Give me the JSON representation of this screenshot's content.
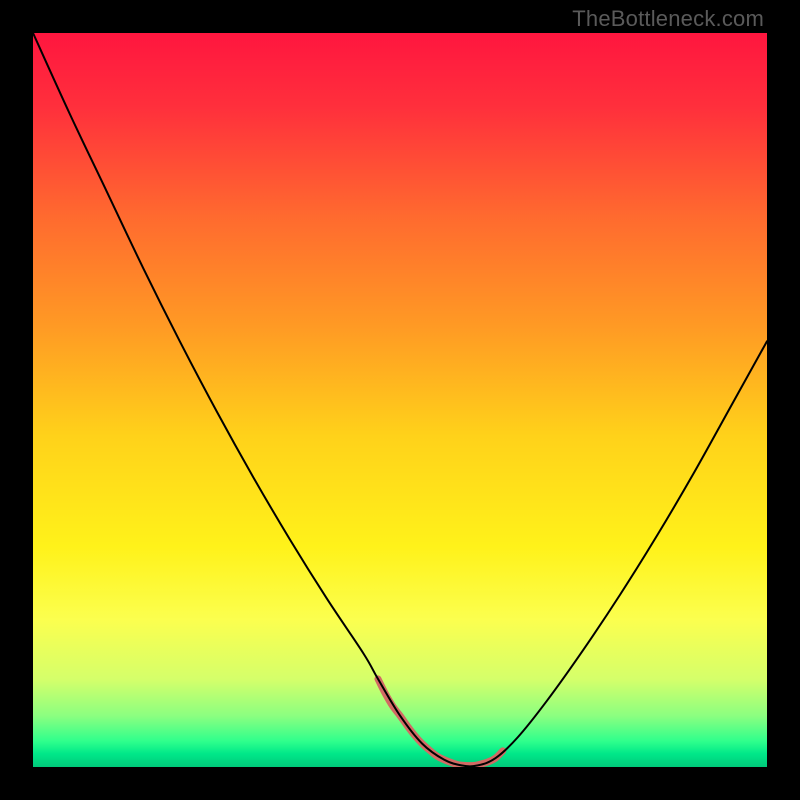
{
  "watermark": "TheBottleneck.com",
  "chart_data": {
    "type": "line",
    "title": "",
    "xlabel": "",
    "ylabel": "",
    "xlim": [
      0,
      100
    ],
    "ylim": [
      0,
      100
    ],
    "grid": false,
    "legend": false,
    "background_gradient": {
      "stops": [
        {
          "offset": 0.0,
          "color": "#ff163f"
        },
        {
          "offset": 0.1,
          "color": "#ff2f3c"
        },
        {
          "offset": 0.25,
          "color": "#ff6a2f"
        },
        {
          "offset": 0.4,
          "color": "#ff9a24"
        },
        {
          "offset": 0.55,
          "color": "#ffd21a"
        },
        {
          "offset": 0.7,
          "color": "#fff21a"
        },
        {
          "offset": 0.8,
          "color": "#fbff4f"
        },
        {
          "offset": 0.88,
          "color": "#d5ff6a"
        },
        {
          "offset": 0.93,
          "color": "#8cff80"
        },
        {
          "offset": 0.965,
          "color": "#2fff8c"
        },
        {
          "offset": 0.982,
          "color": "#00e889"
        },
        {
          "offset": 1.0,
          "color": "#00c97a"
        }
      ]
    },
    "series": [
      {
        "name": "curve",
        "stroke": "#000000",
        "stroke_width": 2,
        "x": [
          0.0,
          5.0,
          10.0,
          15.0,
          20.0,
          25.0,
          30.0,
          35.0,
          40.0,
          45.0,
          47.0,
          50.0,
          53.0,
          56.0,
          58.5,
          60.5,
          63.0,
          66.0,
          70.0,
          75.0,
          80.0,
          85.0,
          90.0,
          95.0,
          100.0
        ],
        "y": [
          100.0,
          89.0,
          78.5,
          68.0,
          58.0,
          48.5,
          39.5,
          31.0,
          23.0,
          15.5,
          12.0,
          7.0,
          3.2,
          1.0,
          0.2,
          0.2,
          1.2,
          4.0,
          9.0,
          16.0,
          23.5,
          31.5,
          40.0,
          49.0,
          58.0
        ]
      },
      {
        "name": "band",
        "stroke": "#d26a64",
        "stroke_width": 7,
        "x": [
          47.0,
          48.0,
          49.0,
          50.0,
          51.0,
          52.0,
          53.0,
          54.0,
          55.0,
          56.0,
          57.0,
          58.0,
          59.0,
          60.0,
          61.0,
          62.0,
          63.0,
          64.0
        ],
        "y": [
          12.0,
          10.0,
          8.3,
          7.0,
          5.6,
          4.3,
          3.2,
          2.3,
          1.5,
          1.0,
          0.6,
          0.3,
          0.2,
          0.2,
          0.4,
          0.7,
          1.2,
          2.2
        ]
      }
    ]
  }
}
